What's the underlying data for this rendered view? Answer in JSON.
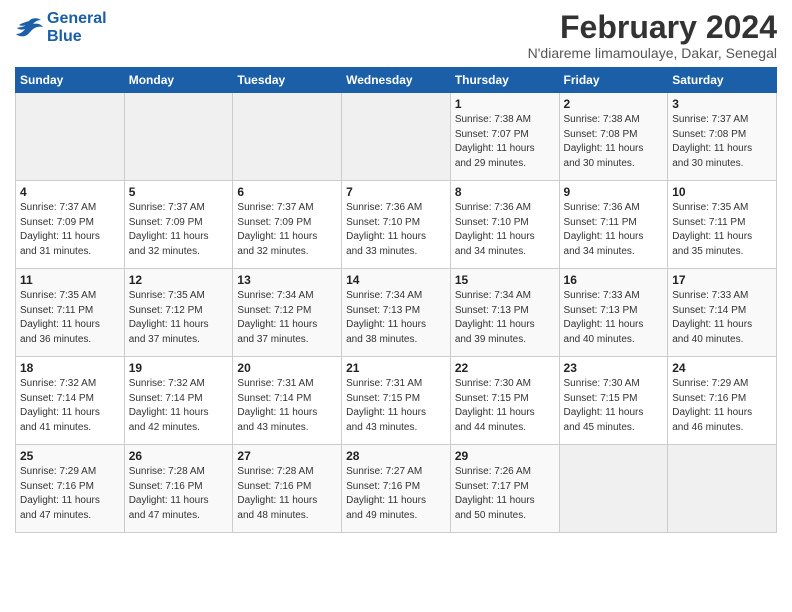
{
  "logo": {
    "line1": "General",
    "line2": "Blue"
  },
  "title": "February 2024",
  "subtitle": "N'diareme limamoulaye, Dakar, Senegal",
  "days_of_week": [
    "Sunday",
    "Monday",
    "Tuesday",
    "Wednesday",
    "Thursday",
    "Friday",
    "Saturday"
  ],
  "weeks": [
    [
      {
        "day": "",
        "info": ""
      },
      {
        "day": "",
        "info": ""
      },
      {
        "day": "",
        "info": ""
      },
      {
        "day": "",
        "info": ""
      },
      {
        "day": "1",
        "info": "Sunrise: 7:38 AM\nSunset: 7:07 PM\nDaylight: 11 hours\nand 29 minutes."
      },
      {
        "day": "2",
        "info": "Sunrise: 7:38 AM\nSunset: 7:08 PM\nDaylight: 11 hours\nand 30 minutes."
      },
      {
        "day": "3",
        "info": "Sunrise: 7:37 AM\nSunset: 7:08 PM\nDaylight: 11 hours\nand 30 minutes."
      }
    ],
    [
      {
        "day": "4",
        "info": "Sunrise: 7:37 AM\nSunset: 7:09 PM\nDaylight: 11 hours\nand 31 minutes."
      },
      {
        "day": "5",
        "info": "Sunrise: 7:37 AM\nSunset: 7:09 PM\nDaylight: 11 hours\nand 32 minutes."
      },
      {
        "day": "6",
        "info": "Sunrise: 7:37 AM\nSunset: 7:09 PM\nDaylight: 11 hours\nand 32 minutes."
      },
      {
        "day": "7",
        "info": "Sunrise: 7:36 AM\nSunset: 7:10 PM\nDaylight: 11 hours\nand 33 minutes."
      },
      {
        "day": "8",
        "info": "Sunrise: 7:36 AM\nSunset: 7:10 PM\nDaylight: 11 hours\nand 34 minutes."
      },
      {
        "day": "9",
        "info": "Sunrise: 7:36 AM\nSunset: 7:11 PM\nDaylight: 11 hours\nand 34 minutes."
      },
      {
        "day": "10",
        "info": "Sunrise: 7:35 AM\nSunset: 7:11 PM\nDaylight: 11 hours\nand 35 minutes."
      }
    ],
    [
      {
        "day": "11",
        "info": "Sunrise: 7:35 AM\nSunset: 7:11 PM\nDaylight: 11 hours\nand 36 minutes."
      },
      {
        "day": "12",
        "info": "Sunrise: 7:35 AM\nSunset: 7:12 PM\nDaylight: 11 hours\nand 37 minutes."
      },
      {
        "day": "13",
        "info": "Sunrise: 7:34 AM\nSunset: 7:12 PM\nDaylight: 11 hours\nand 37 minutes."
      },
      {
        "day": "14",
        "info": "Sunrise: 7:34 AM\nSunset: 7:13 PM\nDaylight: 11 hours\nand 38 minutes."
      },
      {
        "day": "15",
        "info": "Sunrise: 7:34 AM\nSunset: 7:13 PM\nDaylight: 11 hours\nand 39 minutes."
      },
      {
        "day": "16",
        "info": "Sunrise: 7:33 AM\nSunset: 7:13 PM\nDaylight: 11 hours\nand 40 minutes."
      },
      {
        "day": "17",
        "info": "Sunrise: 7:33 AM\nSunset: 7:14 PM\nDaylight: 11 hours\nand 40 minutes."
      }
    ],
    [
      {
        "day": "18",
        "info": "Sunrise: 7:32 AM\nSunset: 7:14 PM\nDaylight: 11 hours\nand 41 minutes."
      },
      {
        "day": "19",
        "info": "Sunrise: 7:32 AM\nSunset: 7:14 PM\nDaylight: 11 hours\nand 42 minutes."
      },
      {
        "day": "20",
        "info": "Sunrise: 7:31 AM\nSunset: 7:14 PM\nDaylight: 11 hours\nand 43 minutes."
      },
      {
        "day": "21",
        "info": "Sunrise: 7:31 AM\nSunset: 7:15 PM\nDaylight: 11 hours\nand 43 minutes."
      },
      {
        "day": "22",
        "info": "Sunrise: 7:30 AM\nSunset: 7:15 PM\nDaylight: 11 hours\nand 44 minutes."
      },
      {
        "day": "23",
        "info": "Sunrise: 7:30 AM\nSunset: 7:15 PM\nDaylight: 11 hours\nand 45 minutes."
      },
      {
        "day": "24",
        "info": "Sunrise: 7:29 AM\nSunset: 7:16 PM\nDaylight: 11 hours\nand 46 minutes."
      }
    ],
    [
      {
        "day": "25",
        "info": "Sunrise: 7:29 AM\nSunset: 7:16 PM\nDaylight: 11 hours\nand 47 minutes."
      },
      {
        "day": "26",
        "info": "Sunrise: 7:28 AM\nSunset: 7:16 PM\nDaylight: 11 hours\nand 47 minutes."
      },
      {
        "day": "27",
        "info": "Sunrise: 7:28 AM\nSunset: 7:16 PM\nDaylight: 11 hours\nand 48 minutes."
      },
      {
        "day": "28",
        "info": "Sunrise: 7:27 AM\nSunset: 7:16 PM\nDaylight: 11 hours\nand 49 minutes."
      },
      {
        "day": "29",
        "info": "Sunrise: 7:26 AM\nSunset: 7:17 PM\nDaylight: 11 hours\nand 50 minutes."
      },
      {
        "day": "",
        "info": ""
      },
      {
        "day": "",
        "info": ""
      }
    ]
  ]
}
